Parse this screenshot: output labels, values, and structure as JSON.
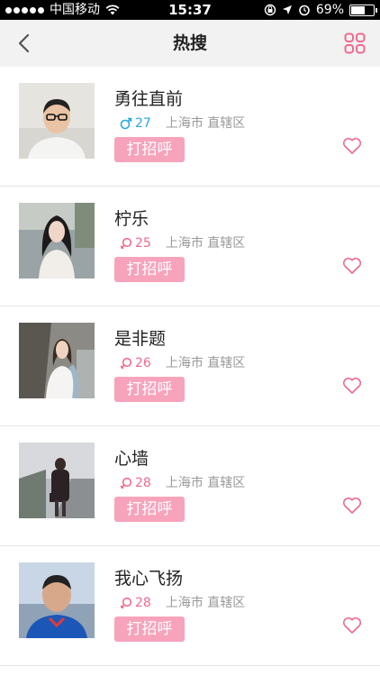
{
  "status_bar": {
    "carrier": "中国移动",
    "time": "15:37",
    "battery": "69%",
    "battery_level": 0.69
  },
  "nav": {
    "title": "热搜",
    "back_icon": "chevron-left-icon",
    "menu_icon": "grid-icon"
  },
  "colors": {
    "accent": "#f7a3bc",
    "male": "#2ba7df",
    "female": "#f06a8f",
    "location": "#999999"
  },
  "users": [
    {
      "name": "勇往直前",
      "gender": "male",
      "age": "27",
      "location": "上海市 直辖区",
      "greet_label": "打招呼"
    },
    {
      "name": "柠乐",
      "gender": "female",
      "age": "25",
      "location": "上海市 直辖区",
      "greet_label": "打招呼"
    },
    {
      "name": "是非题",
      "gender": "female",
      "age": "26",
      "location": "上海市 直辖区",
      "greet_label": "打招呼"
    },
    {
      "name": "心墙",
      "gender": "female",
      "age": "28",
      "location": "上海市 直辖区",
      "greet_label": "打招呼"
    },
    {
      "name": "我心飞扬",
      "gender": "female",
      "age": "28",
      "location": "上海市 直辖区",
      "greet_label": "打招呼"
    }
  ]
}
